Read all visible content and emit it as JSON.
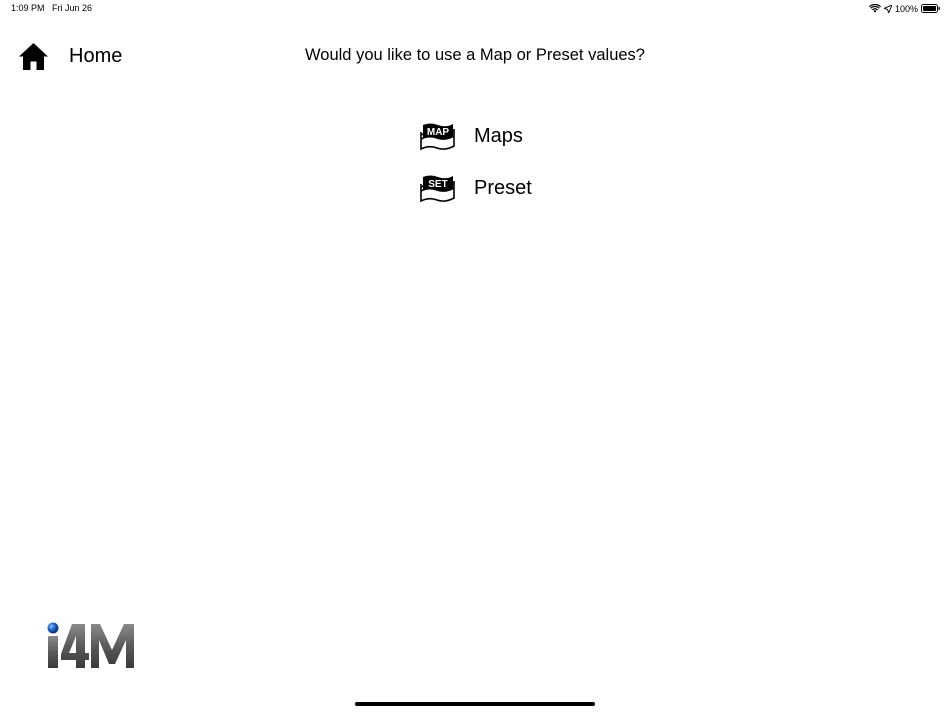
{
  "status_bar": {
    "time": "1:09 PM",
    "date": "Fri Jun 26",
    "battery": "100%",
    "icons": [
      "wifi-icon",
      "location-icon",
      "battery-icon"
    ]
  },
  "nav": {
    "home_label": "Home",
    "home_icon": "house-icon"
  },
  "prompt": {
    "question": "Would you like to use a Map or Preset values?"
  },
  "options": [
    {
      "label": "Maps",
      "icon": "map-icon",
      "icon_text": "MAP"
    },
    {
      "label": "Preset",
      "icon": "set-icon",
      "icon_text": "SET"
    }
  ],
  "logo": {
    "text": "i4M",
    "accent_color": "#1f5fbf"
  }
}
